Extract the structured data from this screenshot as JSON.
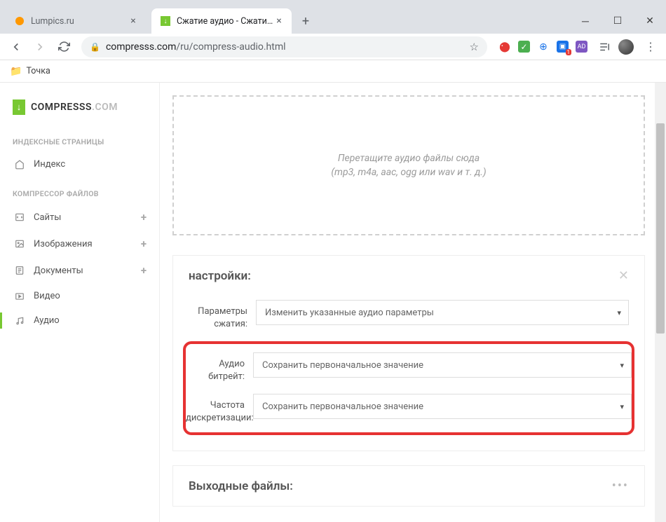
{
  "browser": {
    "tabs": [
      {
        "title": "Lumpics.ru",
        "favicon_color": "#ff9800"
      },
      {
        "title": "Сжатие аудио - Сжатие файлов",
        "favicon_color": "#78c832"
      }
    ],
    "url_domain": "compresss.com",
    "url_path": "/ru/compress-audio.html",
    "bookmark": "Точка"
  },
  "sidebar": {
    "logo": {
      "text": "COMPRESSS",
      "suffix": ".COM"
    },
    "sections": [
      {
        "heading": "ИНДЕКСНЫЕ СТРАНИЦЫ",
        "items": [
          {
            "label": "Индекс",
            "icon": "home"
          }
        ]
      },
      {
        "heading": "КОМПРЕССОР ФАЙЛОВ",
        "items": [
          {
            "label": "Сайты",
            "icon": "code",
            "expandable": true
          },
          {
            "label": "Изображения",
            "icon": "image",
            "expandable": true
          },
          {
            "label": "Документы",
            "icon": "doc",
            "expandable": true
          },
          {
            "label": "Видео",
            "icon": "video"
          },
          {
            "label": "Аудио",
            "icon": "audio",
            "active": true
          }
        ]
      }
    ]
  },
  "dropzone": {
    "line1": "Перетащите аудио файлы сюда",
    "line2": "(mp3, m4a, aac, ogg или wav и т. д.)"
  },
  "settings": {
    "title": "настройки:",
    "rows": [
      {
        "label": "Параметры сжатия:",
        "value": "Изменить указанные аудио параметры"
      },
      {
        "label": "Аудио битрейт:",
        "value": "Сохранить первоначальное значение"
      },
      {
        "label": "Частота дискретизации:",
        "value": "Сохранить первоначальное значение"
      }
    ]
  },
  "output": {
    "title": "Выходные файлы:"
  }
}
